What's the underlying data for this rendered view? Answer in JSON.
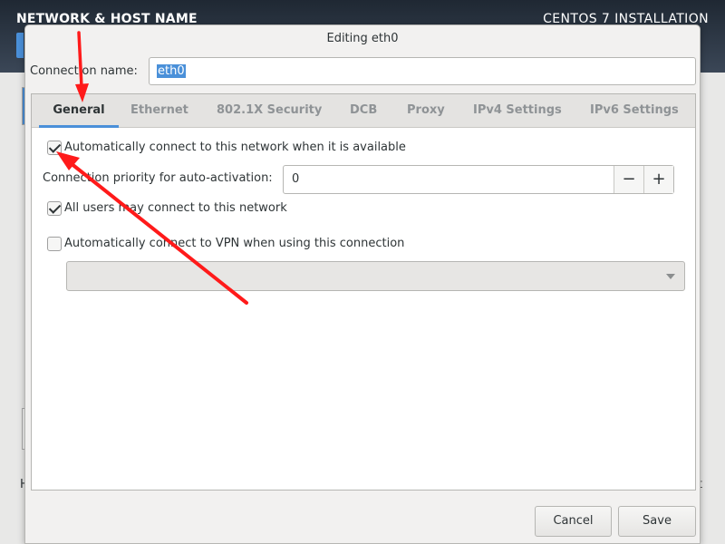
{
  "background": {
    "title": "NETWORK & HOST NAME",
    "product": "CENTOS 7 INSTALLATION",
    "left_fragment": "H",
    "right_fragment": "t"
  },
  "dialog": {
    "title": "Editing eth0",
    "connection_name_label": "Connection name:",
    "connection_name_value": "eth0",
    "tabs": [
      {
        "label": "General",
        "active": true
      },
      {
        "label": "Ethernet",
        "active": false
      },
      {
        "label": "802.1X Security",
        "active": false
      },
      {
        "label": "DCB",
        "active": false
      },
      {
        "label": "Proxy",
        "active": false
      },
      {
        "label": "IPv4 Settings",
        "active": false
      },
      {
        "label": "IPv6 Settings",
        "active": false
      }
    ],
    "general": {
      "auto_connect": {
        "label": "Automatically connect to this network when it is available",
        "checked": true
      },
      "priority": {
        "label": "Connection priority for auto-activation:",
        "value": "0",
        "minus": "−",
        "plus": "+"
      },
      "all_users": {
        "label": "All users may connect to this network",
        "checked": true
      },
      "auto_vpn": {
        "label": "Automatically connect to VPN when using this connection",
        "checked": false
      },
      "vpn_selected": ""
    },
    "buttons": {
      "cancel": "Cancel",
      "save": "Save"
    }
  },
  "colors": {
    "accent": "#4a90d9",
    "annotation_arrow": "#ff1a1a"
  }
}
